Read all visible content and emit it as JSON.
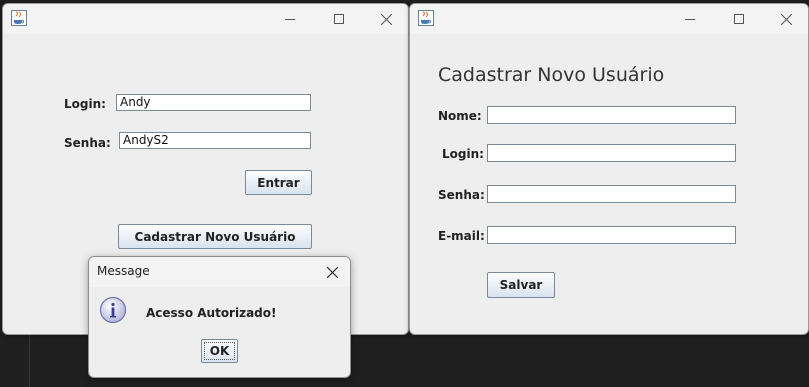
{
  "login_window": {
    "login_label": "Login:",
    "login_value": "Andy",
    "password_label": "Senha:",
    "password_value": "AndyS2",
    "enter_button": "Entrar",
    "register_button": "Cadastrar Novo Usuário"
  },
  "register_window": {
    "heading": "Cadastrar Novo Usuário",
    "name_label": "Nome:",
    "login_label": "Login:",
    "password_label": "Senha:",
    "email_label": "E-mail:",
    "save_button": "Salvar"
  },
  "dialog": {
    "title": "Message",
    "message": "Acesso Autorizado!",
    "ok_button": "OK"
  },
  "icons": [
    "java-icon",
    "minimize-icon",
    "maximize-icon",
    "close-icon",
    "info-icon"
  ]
}
